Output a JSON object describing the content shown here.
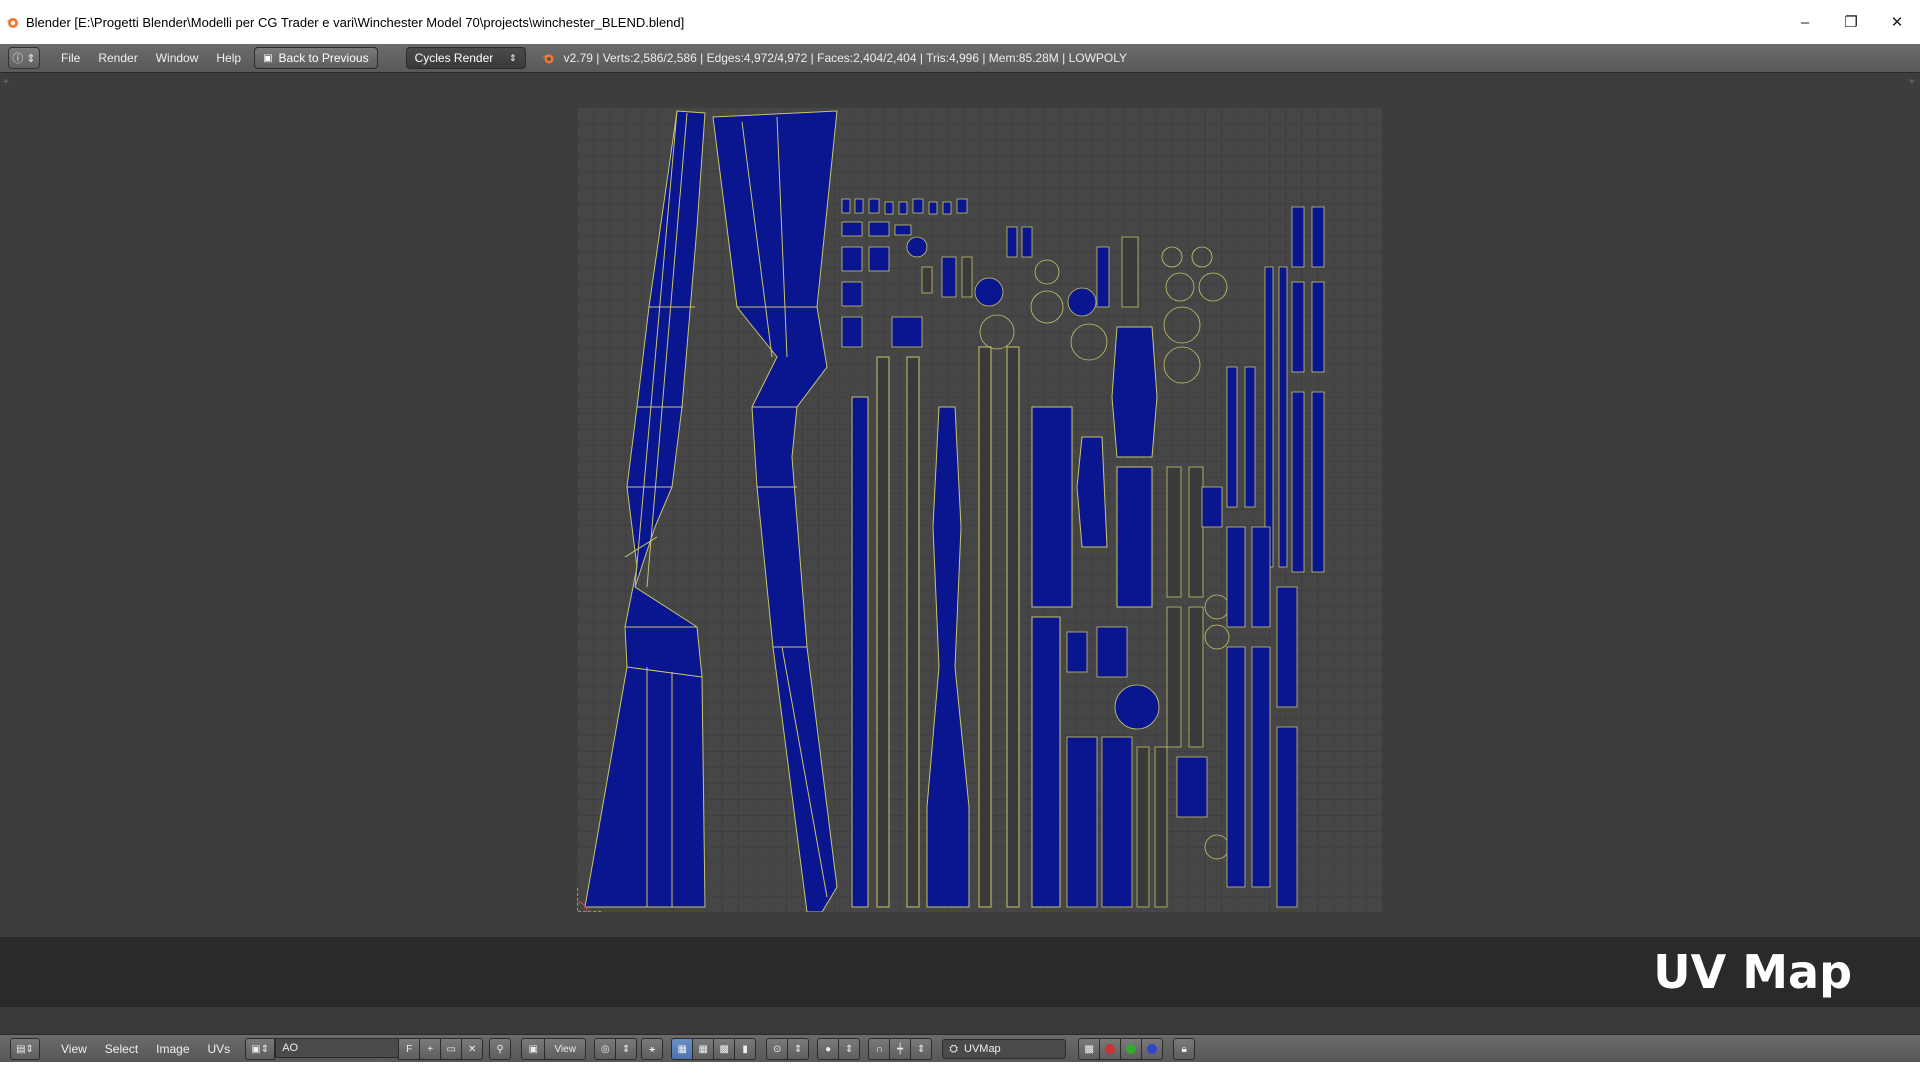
{
  "window": {
    "title": "Blender [E:\\Progetti Blender\\Modelli per CG Trader e vari\\Winchester Model 70\\projects\\winchester_BLEND.blend]",
    "controls": {
      "minimize": "–",
      "restore": "❐",
      "close": "✕"
    }
  },
  "info_header": {
    "menus": [
      "File",
      "Render",
      "Window",
      "Help"
    ],
    "back_button": "Back to Previous",
    "render_engine": "Cycles Render",
    "stats": "v2.79 | Verts:2,586/2,586 | Edges:4,972/4,972 | Faces:2,404/2,404 | Tris:4,996 | Mem:85.28M | LOWPOLY"
  },
  "editor": {
    "caption": "UV Map"
  },
  "bottom_header": {
    "menus": [
      "View",
      "Select",
      "Image",
      "UVs"
    ],
    "image_name": "AO",
    "fake_user": "F",
    "view_select": "View",
    "uv_map": "UVMap"
  },
  "colors": {
    "uv_face": "#0a1590",
    "uv_edge": "#c9c56b",
    "grid_bg": "#464646",
    "editor_bg": "#3d3d3d"
  }
}
